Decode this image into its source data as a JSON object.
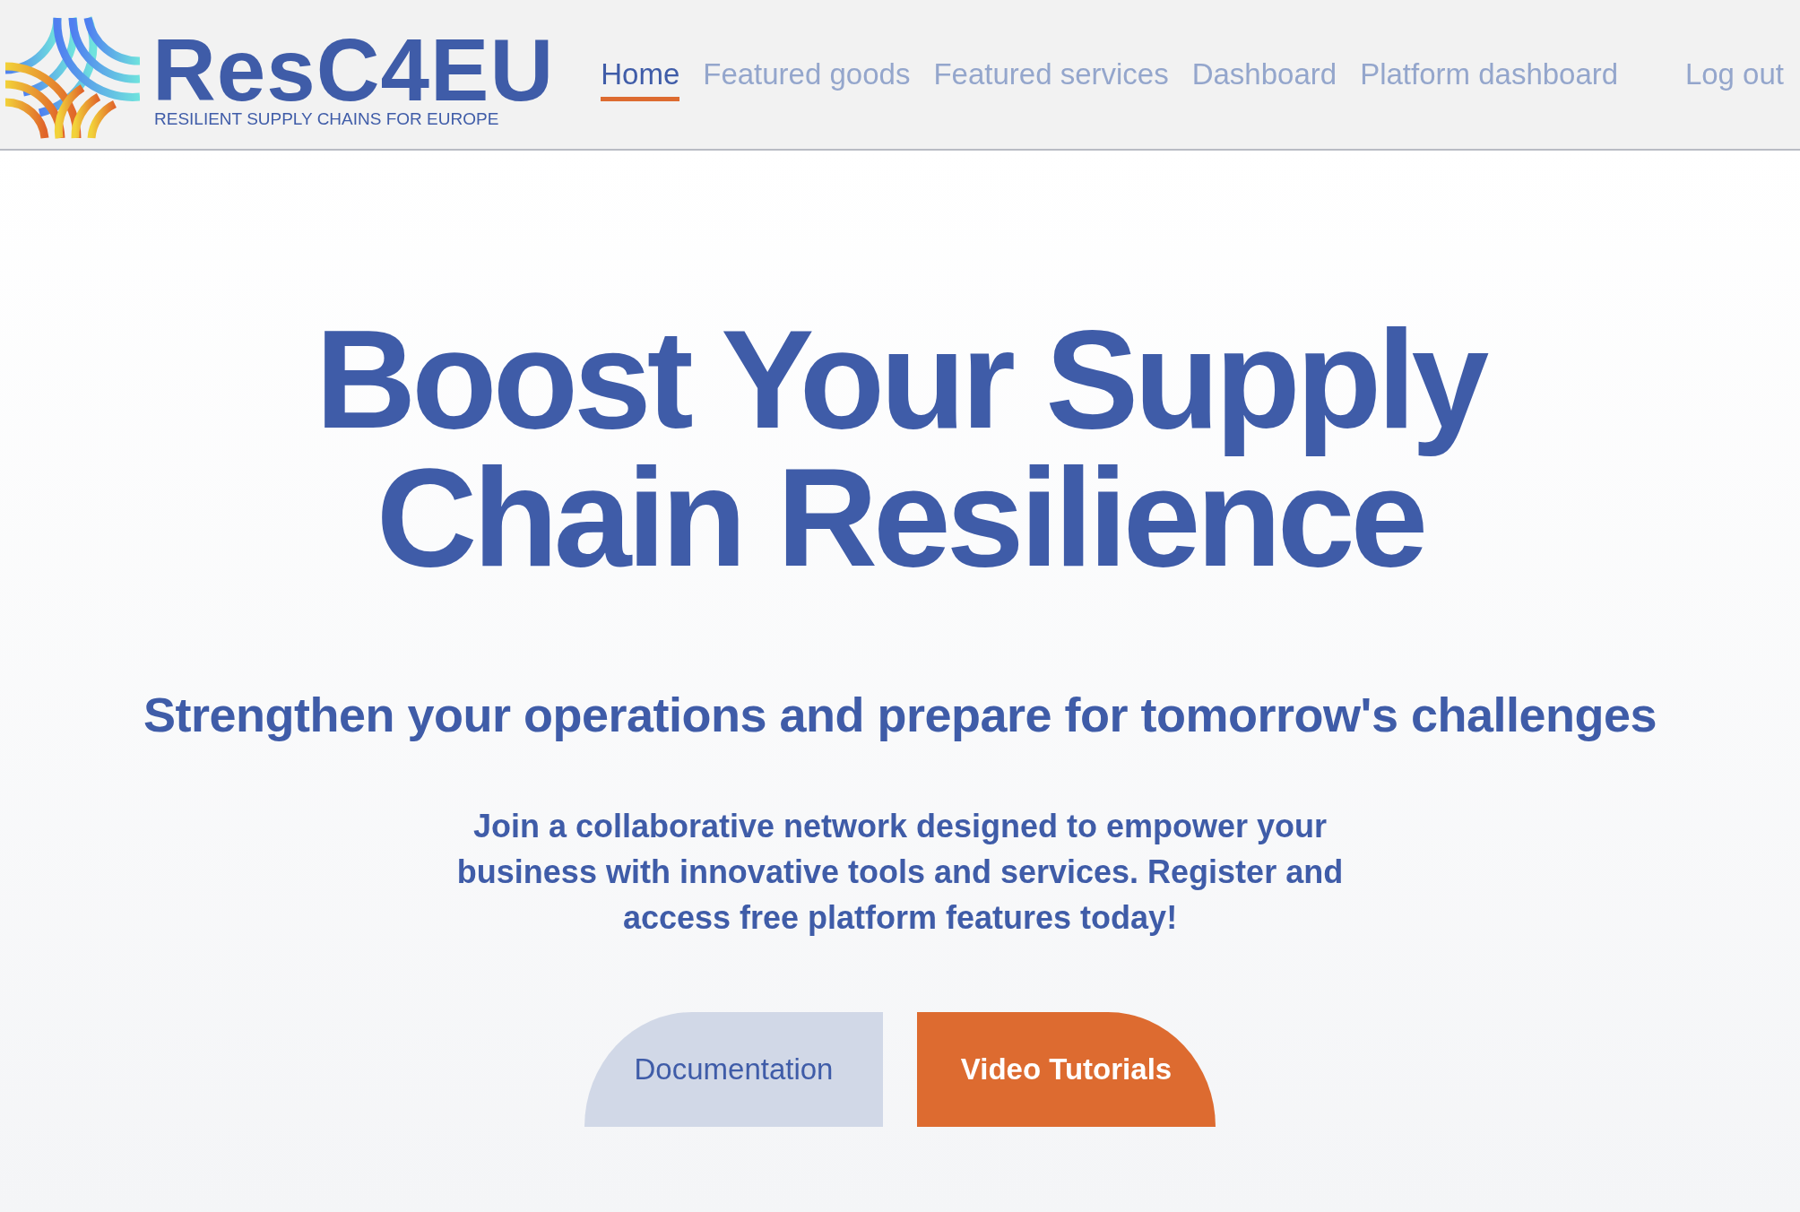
{
  "brand": {
    "name": "ResC4EU",
    "tagline": "RESILIENT SUPPLY CHAINS FOR EUROPE"
  },
  "nav": [
    {
      "label": "Home",
      "selected": true
    },
    {
      "label": "Featured goods",
      "selected": false
    },
    {
      "label": "Featured services",
      "selected": false
    },
    {
      "label": "Dashboard",
      "selected": false
    },
    {
      "label": "Platform dashboard",
      "selected": false
    }
  ],
  "logout": "Log out",
  "hero": {
    "title": "Boost Your Supply Chain Resilience",
    "subtitle": "Strengthen your operations and prepare for tomorrow's challenges",
    "text": "Join a collaborative network designed to empower your business with innovative tools and services. Register and access free platform features today!"
  },
  "buttons": [
    {
      "label": "Documentation",
      "kind": "secondary"
    },
    {
      "label": "Video Tutorials",
      "kind": "primary"
    }
  ]
}
